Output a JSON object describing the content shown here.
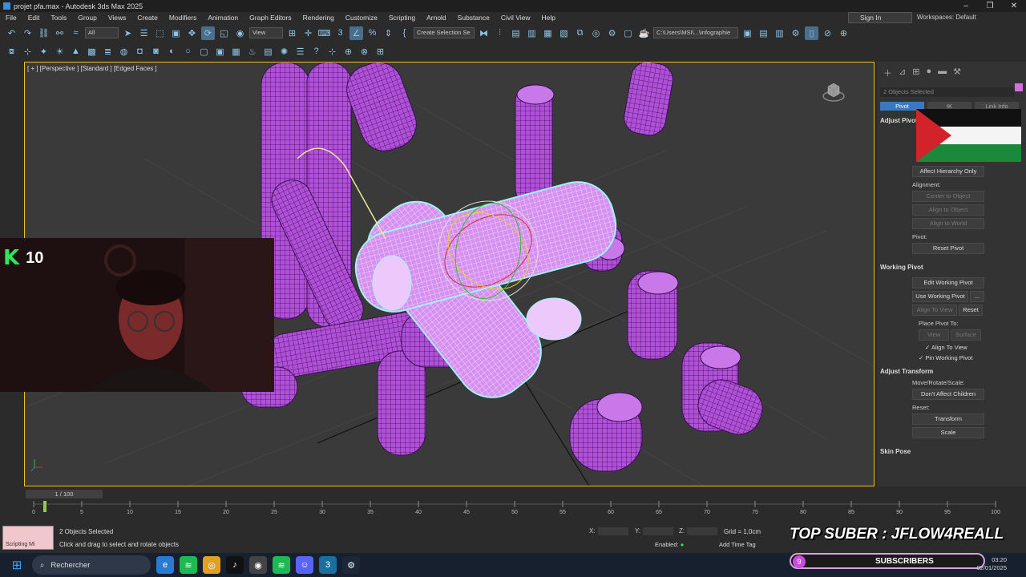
{
  "window": {
    "title": "projet pfa.max - Autodesk 3ds Max 2025",
    "controls": [
      "–",
      "❐",
      "✕"
    ]
  },
  "menu": {
    "items": [
      "File",
      "Edit",
      "Tools",
      "Group",
      "Views",
      "Create",
      "Modifiers",
      "Animation",
      "Graph Editors",
      "Rendering",
      "Customize",
      "Scripting",
      "Arnold",
      "Substance",
      "Civil View",
      "Help"
    ]
  },
  "signin": {
    "label": "Sign In"
  },
  "workspaces": {
    "label": "Workspaces: Default"
  },
  "toolbar": {
    "filter_value": "All",
    "view_value": "View",
    "selection_set_placeholder": "Create Selection Se",
    "path_value": "C:\\Users\\MSI\\...\\infographie"
  },
  "viewport": {
    "label": "[ + ] [Perspective ] [Standard ] [Edged Faces ]"
  },
  "command_panel": {
    "selection": "2 Objects Selected",
    "tabs": [
      "Pivot",
      "IK",
      "Link Info"
    ],
    "adjust_pivot": "Adjust Pivot",
    "affect_hierarchy": "Affect Hierarchy Only",
    "alignment_label": "Alignment:",
    "center_to_object": "Center to Object",
    "align_to_object": "Align to Object",
    "align_to_world": "Align to World",
    "pivot_label": "Pivot:",
    "reset_pivot": "Reset Pivot",
    "working_pivot": "Working Pivot",
    "edit_working_pivot": "Edit Working Pivot",
    "use_working_pivot": "Use Working Pivot",
    "ellipsis": "...",
    "align_to_view_btn": "Align To View",
    "reset": "Reset",
    "place_pivot_to": "Place Pivot To:",
    "view": "View",
    "surface": "Surface",
    "align_to_view_chk": "Align To View",
    "pin_working_pivot": "Pin Working Pivot",
    "adjust_transform": "Adjust Transform",
    "move_rotate_scale": "Move/Rotate/Scale:",
    "dont_affect_children": "Don't Affect Children",
    "reset_label": "Reset:",
    "transform": "Transform",
    "scale": "Scale",
    "skin_pose": "Skin Pose"
  },
  "webcam": {
    "badge_letter": "K",
    "badge_count": "10"
  },
  "timeline": {
    "frame_label": "1 / 100",
    "ticks": [
      "0",
      "5",
      "10",
      "15",
      "20",
      "25",
      "30",
      "35",
      "40",
      "45",
      "50",
      "55",
      "60",
      "65",
      "70",
      "75",
      "80",
      "85",
      "90",
      "95",
      "100"
    ]
  },
  "status": {
    "maxscript_label": "Scripting Mi",
    "selected": "2 Objects Selected",
    "prompt": "Click and drag to select and rotate objects",
    "x_label": "X:",
    "y_label": "Y:",
    "z_label": "Z:",
    "grid": "Grid = 1,0cm",
    "enabled": "Enabled:",
    "add_time_tag": "Add Time Tag"
  },
  "overlay": {
    "top_suber": "TOP SUBER : JFLOW4REALL",
    "subscribers_label": "SUBSCRIBERS",
    "subscribers_count": "9"
  },
  "taskbar": {
    "search_placeholder": "Rechercher",
    "time": "03:20",
    "date": "02/01/2025"
  },
  "colors": {
    "accent": "#3a78c0",
    "mesh": "#b050d8",
    "selection": "#9ef5f0",
    "viewport_border": "#f0c020"
  }
}
